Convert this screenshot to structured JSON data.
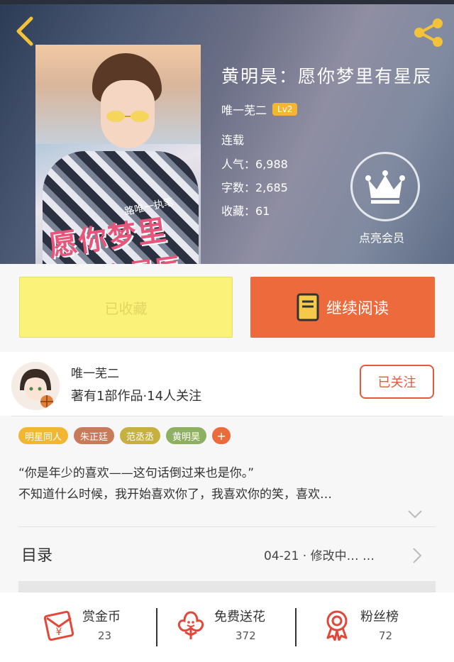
{
  "nav": {
    "back_icon": "back-chevron-icon",
    "share_icon": "share-icon"
  },
  "book": {
    "title": "黄明昊：愿你梦里有星辰",
    "author": "唯一芜二",
    "level": "Lv2",
    "status": "连载",
    "popularity": "人气：6,988",
    "words": "字数：2,685",
    "favorites": "收藏：61",
    "cover_title_1": "愿你梦里",
    "cover_title_2": "有星辰",
    "cover_subtitle": "路唯一执笔"
  },
  "vip": {
    "label": "点亮会员",
    "icon": "crown-icon"
  },
  "actions": {
    "favorited_label": "已收藏",
    "continue_label": "继续阅读"
  },
  "author_card": {
    "name": "唯一芜二",
    "desc": "著有1部作品·14人关注",
    "follow_label": "已关注"
  },
  "tags": [
    {
      "label": "明星同人",
      "color": "#f2b632"
    },
    {
      "label": "朱正廷",
      "color": "#c87a5a"
    },
    {
      "label": "范丞丞",
      "color": "#c6b03e"
    },
    {
      "label": "黄明昊",
      "color": "#8fb060"
    }
  ],
  "tag_more": "+",
  "synopsis": {
    "line1": "“你是年少的喜欢——这句话倒过来也是你。”",
    "line2": "不知道什么时候，我开始喜欢你了，我喜欢你的笑，喜欢…"
  },
  "catalog": {
    "title": "目录",
    "update": "04-21 · 修改中… …"
  },
  "stats": [
    {
      "label": "赏金币",
      "value": "23",
      "icon": "gold-coin-red-packet-icon"
    },
    {
      "label": "免费送花",
      "value": "372",
      "icon": "flower-icon"
    },
    {
      "label": "粉丝榜",
      "value": "72",
      "icon": "rosette-medal-icon"
    }
  ],
  "colors": {
    "accent": "#ec6a3c",
    "favorite_bg": "#fbf27a",
    "follow": "#e25a3c",
    "badge": "#f2b632"
  }
}
